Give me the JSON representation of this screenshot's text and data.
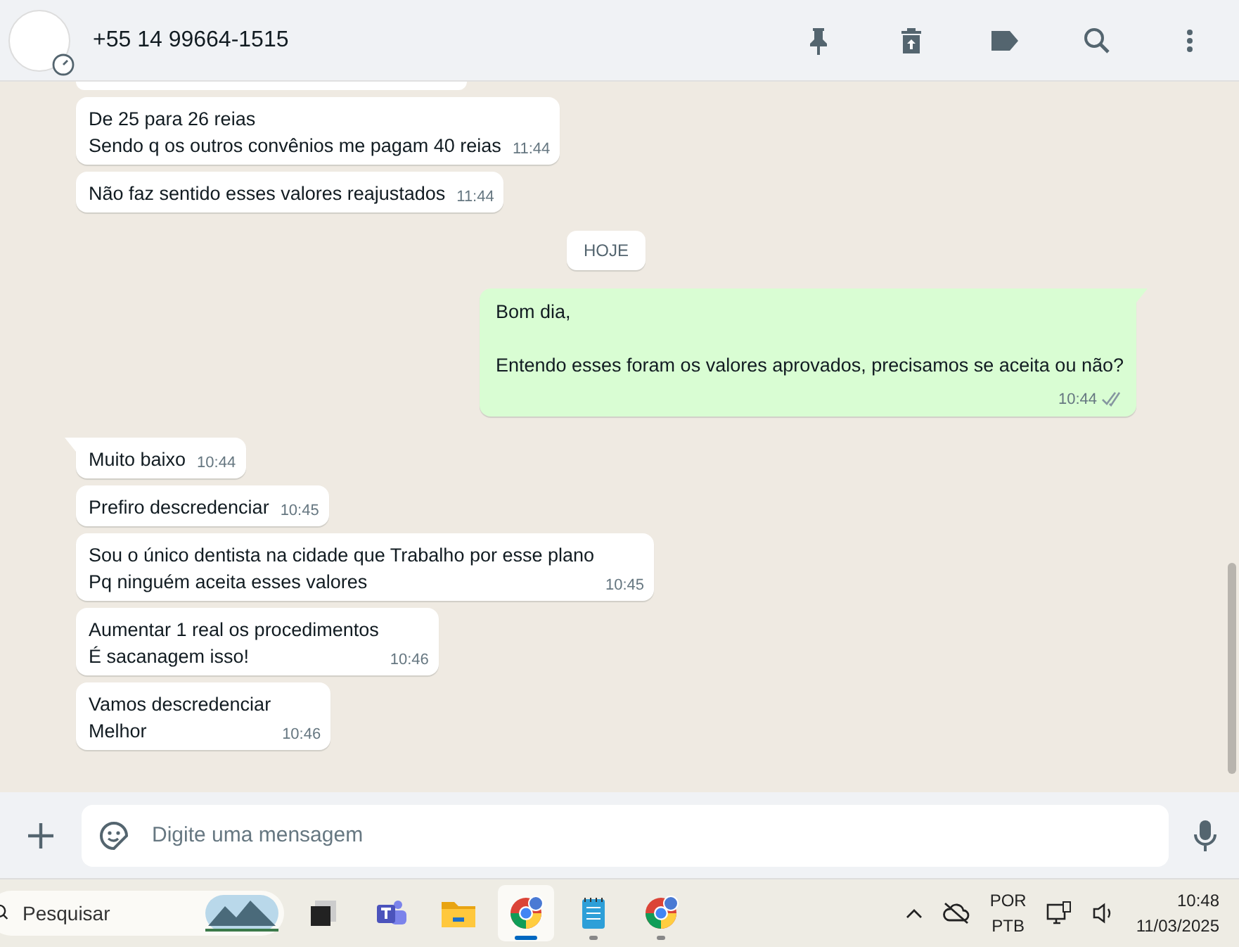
{
  "header": {
    "contact": "+55 14 99664-1515"
  },
  "messages": [
    {
      "kind": "clipped"
    },
    {
      "kind": "in",
      "text": "De 25 para 26 reias\nSendo q os outros convênios me pagam 40 reias",
      "time": "11:44"
    },
    {
      "kind": "in",
      "text": "Não faz sentido esses valores reajustados",
      "time": "11:44"
    },
    {
      "kind": "date",
      "text": "HOJE"
    },
    {
      "kind": "out",
      "text": "Bom dia,\n\nEntendo esses foram os valores aprovados, precisamos se aceita ou não?",
      "time": "10:44",
      "read": false
    },
    {
      "kind": "in",
      "text": "Muito baixo",
      "time": "10:44",
      "tail": true
    },
    {
      "kind": "in",
      "text": "Prefiro descredenciar",
      "time": "10:45"
    },
    {
      "kind": "in",
      "text": "Sou o único dentista na cidade que Trabalho por esse plano\nPq ninguém aceita esses valores",
      "time": "10:45"
    },
    {
      "kind": "in",
      "text": "Aumentar 1 real os procedimentos\nÉ sacanagem isso!",
      "time": "10:46"
    },
    {
      "kind": "in",
      "text": "Vamos descredenciar\nMelhor",
      "time": "10:46"
    }
  ],
  "composer": {
    "placeholder": "Digite uma mensagem"
  },
  "taskbar": {
    "search_placeholder": "Pesquisar",
    "apps": [
      {
        "kind": "widget",
        "selected": false,
        "open": false
      },
      {
        "kind": "teams",
        "selected": false,
        "open": false
      },
      {
        "kind": "folder",
        "selected": false,
        "open": false
      },
      {
        "kind": "chrome",
        "selected": true,
        "open": true
      },
      {
        "kind": "notepad",
        "selected": false,
        "open": true
      },
      {
        "kind": "chrome",
        "selected": false,
        "open": true
      }
    ],
    "lang": "POR",
    "layout": "PTB",
    "time": "10:48",
    "date": "11/03/2025"
  }
}
